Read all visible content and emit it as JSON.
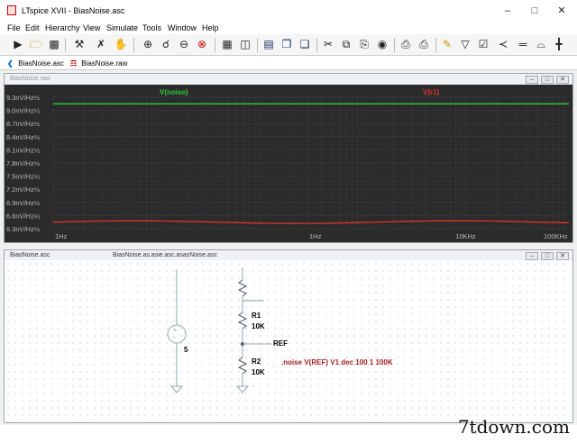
{
  "window": {
    "title": "LTspice XVII - BiasNoise.asc"
  },
  "menu": [
    "File",
    "Edit",
    "Hierarchy",
    "View",
    "Simulate",
    "Tools",
    "Window",
    "Help"
  ],
  "toolbar": {
    "buttons": [
      "run-icon",
      "open-icon",
      "save-icon",
      "control-panel-icon",
      "halt-icon",
      "pan-icon",
      "zoom-in-icon",
      "zoom-pan-icon",
      "zoom-out-icon",
      "zoom-full-icon",
      "autoscale-icon",
      "tile-icon",
      "cascade-icon",
      "close-all-icon",
      "cut-icon",
      "copy-icon",
      "paste-icon",
      "find-icon",
      "print-setup-icon",
      "print-icon",
      "draw-wire-icon",
      "ground-icon",
      "label-net-icon",
      "resistor-icon",
      "capacitor-icon",
      "inductor-icon"
    ]
  },
  "tabs": [
    {
      "label": "BiasNoise.asc",
      "icon": "schematic-icon"
    },
    {
      "label": "BiasNoise.raw",
      "icon": "waveform-icon"
    }
  ],
  "waveform_pane": {
    "title": "BiasNoise.raw"
  },
  "schematic_pane": {
    "title": "BiasNoise.asc",
    "center_title": "BiasNoise.as.asie.asc.asasNoise.asc"
  },
  "chart_data": {
    "type": "line",
    "series": [
      {
        "name": "V(noise)",
        "color": "#2ecc40",
        "x": [
          1,
          100000
        ],
        "y": [
          9.15,
          9.15
        ]
      },
      {
        "name": "V(r1)",
        "color": "#e0342b",
        "x": [
          1,
          100000
        ],
        "y": [
          6.45,
          6.45
        ]
      }
    ],
    "x_ticks": [
      "1Hz",
      "1Hz",
      "10KHz",
      "100KHz"
    ],
    "y_ticks": [
      "9.3nV/Hz½",
      "9.0nV/Hz½",
      "8.7nV/Hz½",
      "8.4nV/Hz½",
      "8.1nV/Hz½",
      "7.8nV/Hz½",
      "7.5nV/Hz½",
      "7.2nV/Hz½",
      "6.9nV/Hz½",
      "6.6nV/Hz½",
      "6.3nV/Hz½"
    ],
    "ylim": [
      6.3,
      9.3
    ],
    "xscale": "log",
    "grid": true,
    "background": "#2b2b2b"
  },
  "schematic": {
    "source_label": "5",
    "r1": {
      "name": "R1",
      "value": "10K"
    },
    "r2": {
      "name": "R2",
      "value": "10K"
    },
    "net_label": "REF",
    "directive": ".noise V(REF) V1 dec 100 1 100K"
  },
  "watermark": "7tdown.com"
}
